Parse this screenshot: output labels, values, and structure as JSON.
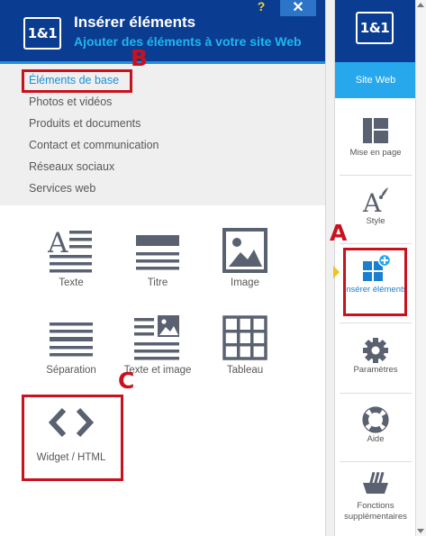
{
  "panel": {
    "logo": "1&1",
    "title": "Insérer éléments",
    "subtitle": "Ajouter des éléments à votre site Web",
    "help_label": "?",
    "close_label": "✕",
    "categories": [
      "Éléments de base",
      "Photos et vidéos",
      "Produits et documents",
      "Contact et communication",
      "Réseaux sociaux",
      "Services web"
    ],
    "active_category": "Éléments de base",
    "elements": [
      {
        "label": "Texte",
        "icon": "text-icon"
      },
      {
        "label": "Titre",
        "icon": "title-icon"
      },
      {
        "label": "Image",
        "icon": "image-icon"
      },
      {
        "label": "Séparation",
        "icon": "separator-icon"
      },
      {
        "label": "Texte et image",
        "icon": "text-image-icon"
      },
      {
        "label": "Tableau",
        "icon": "table-icon"
      },
      {
        "label": "Widget / HTML",
        "icon": "code-brackets-icon"
      }
    ]
  },
  "sidebar": {
    "logo": "1&1",
    "site_label": "Site Web",
    "items": [
      {
        "label": "Mise en page",
        "icon": "layout-icon"
      },
      {
        "label": "Style",
        "icon": "style-font-brush-icon"
      },
      {
        "label": "Insérer éléments",
        "icon": "insert-elements-plus-icon"
      },
      {
        "label": "Paramètres",
        "icon": "gear-icon"
      },
      {
        "label": "Aide",
        "icon": "lifebuoy-icon"
      },
      {
        "label": "Fonctions supplémentaires",
        "icon": "basket-icon"
      }
    ],
    "active_item": "Insérer éléments"
  },
  "annotations": {
    "a": "A",
    "b": "B",
    "c": "C"
  },
  "colors": {
    "header_blue": "#0a3d91",
    "accent_blue": "#27a7ec",
    "annotation_red": "#c8121d",
    "icon_gray": "#5a6170"
  }
}
